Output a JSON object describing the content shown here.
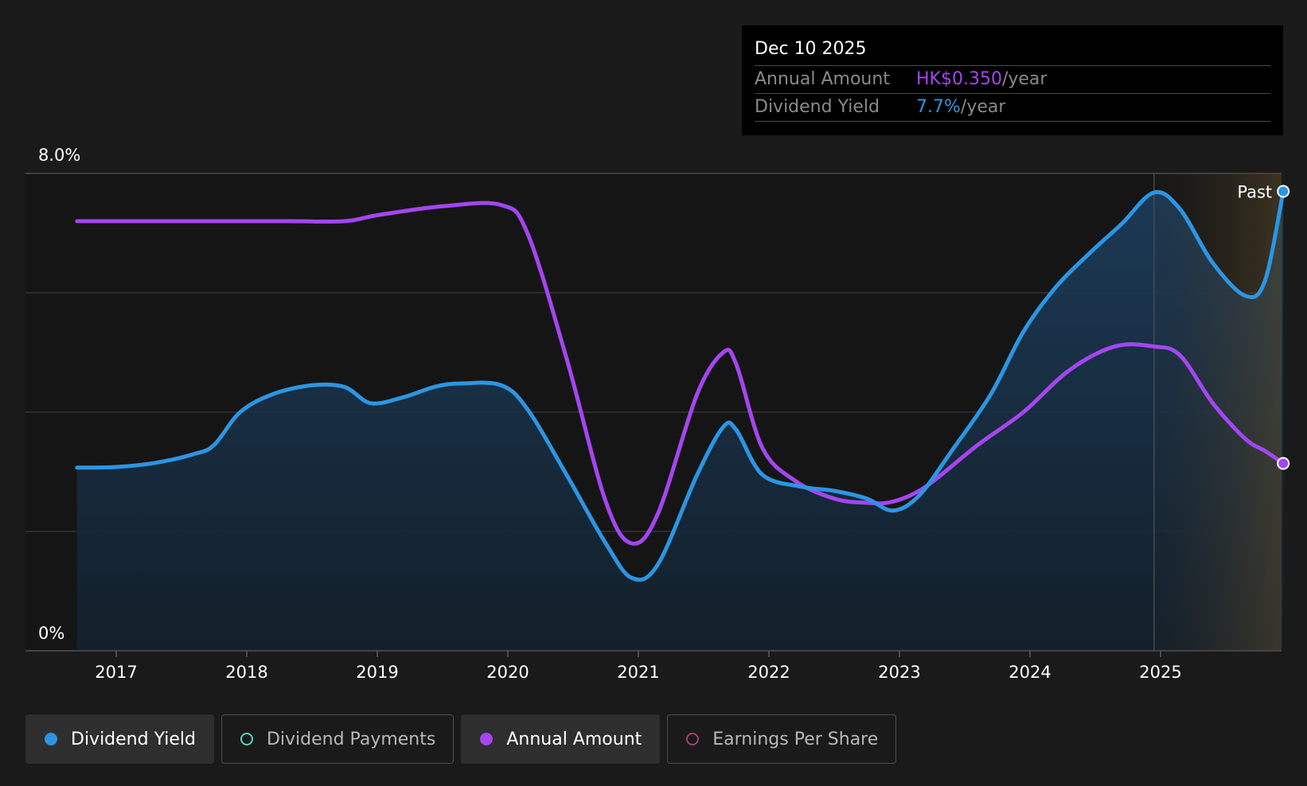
{
  "tooltip": {
    "date": "Dec 10 2025",
    "annual_amount_label": "Annual Amount",
    "annual_amount_value": "HK$0.350",
    "dividend_yield_label": "Dividend Yield",
    "dividend_yield_value": "7.7%",
    "per_year": "/year"
  },
  "colors": {
    "dividend_yield": "#2b95e3",
    "annual_amount": "#a445f0",
    "dividend_payments": "#5fcfc0",
    "earnings_per_share": "#a63f74",
    "background": "#1a1a1a",
    "past_marker": "#ffffff"
  },
  "legend": [
    {
      "label": "Dividend Yield",
      "active": true,
      "color": "#2b95e3"
    },
    {
      "label": "Dividend Payments",
      "active": false,
      "color": "#5fcfc0"
    },
    {
      "label": "Annual Amount",
      "active": true,
      "color": "#a445f0"
    },
    {
      "label": "Earnings Per Share",
      "active": false,
      "color": "#a63f74"
    }
  ],
  "chart_data": {
    "type": "line",
    "title": "",
    "xlabel": "",
    "ylabel": "",
    "ylim": [
      0,
      8
    ],
    "y_tick_labels": [
      "8.0%",
      "0%"
    ],
    "x_tick_labels": [
      "2017",
      "2018",
      "2019",
      "2020",
      "2021",
      "2022",
      "2023",
      "2024",
      "2025"
    ],
    "xlim": [
      2016.7,
      2025.94
    ],
    "grid": true,
    "legend_position": "bottom",
    "past_label": "Past",
    "forecast_start": 2024.95,
    "series": [
      {
        "name": "Dividend Yield",
        "area": true,
        "x": [
          2016.7,
          2017.0,
          2017.3,
          2017.6,
          2017.75,
          2017.95,
          2018.2,
          2018.5,
          2018.75,
          2018.95,
          2019.2,
          2019.45,
          2019.65,
          2019.95,
          2020.15,
          2020.45,
          2020.75,
          2020.95,
          2021.15,
          2021.45,
          2021.65,
          2021.75,
          2021.95,
          2022.25,
          2022.5,
          2022.75,
          2022.95,
          2023.15,
          2023.4,
          2023.7,
          2023.95,
          2024.2,
          2024.45,
          2024.7,
          2024.95,
          2025.15,
          2025.4,
          2025.65,
          2025.8,
          2025.94
        ],
        "values": [
          3.07,
          3.08,
          3.15,
          3.3,
          3.45,
          4.0,
          4.3,
          4.45,
          4.42,
          4.15,
          4.25,
          4.43,
          4.48,
          4.45,
          4.05,
          2.95,
          1.8,
          1.22,
          1.45,
          2.95,
          3.75,
          3.7,
          2.95,
          2.75,
          2.68,
          2.55,
          2.35,
          2.6,
          3.35,
          4.3,
          5.35,
          6.1,
          6.65,
          7.15,
          7.68,
          7.4,
          6.5,
          5.95,
          6.2,
          7.7
        ]
      },
      {
        "name": "Annual Amount",
        "area": false,
        "x": [
          2016.7,
          2017.5,
          2018.3,
          2018.75,
          2019.0,
          2019.5,
          2019.95,
          2020.15,
          2020.45,
          2020.75,
          2020.95,
          2021.15,
          2021.45,
          2021.65,
          2021.75,
          2021.95,
          2022.2,
          2022.5,
          2022.75,
          2022.95,
          2023.2,
          2023.6,
          2023.95,
          2024.3,
          2024.65,
          2024.95,
          2025.15,
          2025.4,
          2025.65,
          2025.8,
          2025.94
        ],
        "values": [
          7.2,
          7.2,
          7.2,
          7.2,
          7.3,
          7.45,
          7.47,
          7.0,
          4.9,
          2.5,
          1.8,
          2.3,
          4.3,
          5.0,
          4.8,
          3.4,
          2.85,
          2.55,
          2.48,
          2.5,
          2.75,
          3.45,
          4.0,
          4.7,
          5.1,
          5.1,
          4.95,
          4.15,
          3.55,
          3.35,
          3.14
        ]
      }
    ]
  }
}
